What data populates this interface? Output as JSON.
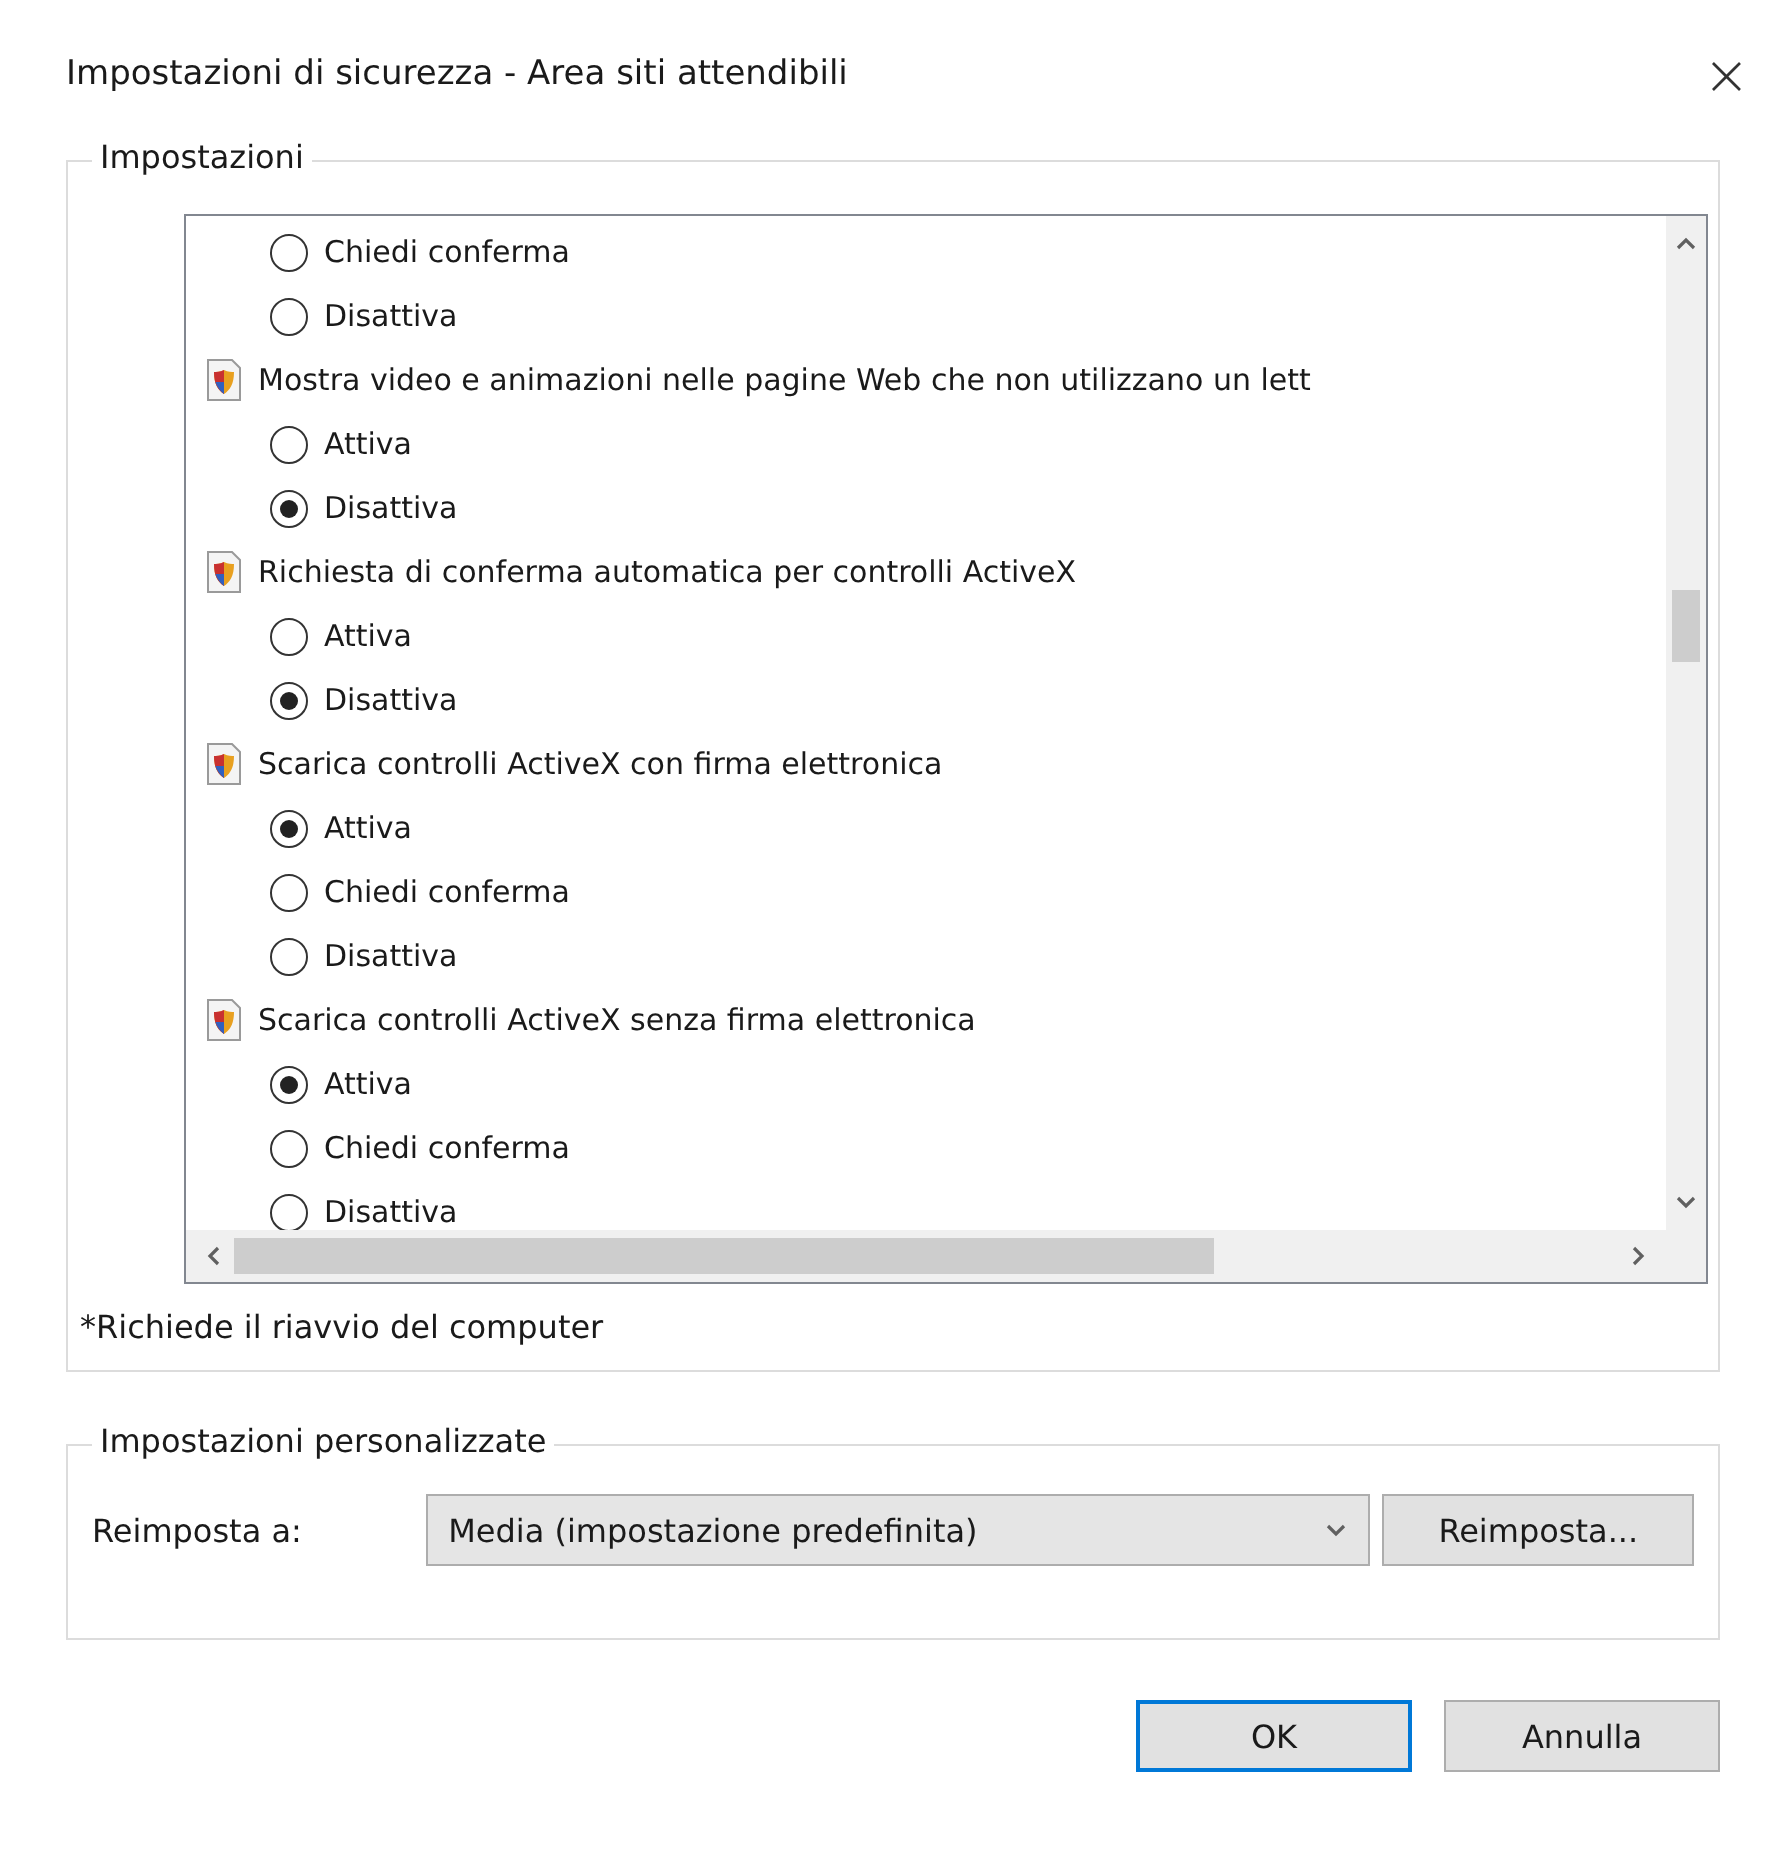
{
  "window": {
    "title": "Impostazioni di sicurezza - Area siti attendibili",
    "close": "×"
  },
  "settings": {
    "legend": "Impostazioni",
    "groups": [
      {
        "options": [
          {
            "label": "Chiedi conferma",
            "selected": false
          },
          {
            "label": "Disattiva",
            "selected": false
          }
        ]
      },
      {
        "title": "Mostra video e animazioni nelle pagine Web che non utilizzano un lett",
        "options": [
          {
            "label": "Attiva",
            "selected": false
          },
          {
            "label": "Disattiva",
            "selected": true
          }
        ]
      },
      {
        "title": "Richiesta di conferma automatica per controlli ActiveX",
        "options": [
          {
            "label": "Attiva",
            "selected": false
          },
          {
            "label": "Disattiva",
            "selected": true
          }
        ]
      },
      {
        "title": "Scarica controlli ActiveX con firma elettronica",
        "options": [
          {
            "label": "Attiva",
            "selected": true
          },
          {
            "label": "Chiedi conferma",
            "selected": false
          },
          {
            "label": "Disattiva",
            "selected": false
          }
        ]
      },
      {
        "title": "Scarica controlli ActiveX senza firma elettronica",
        "options": [
          {
            "label": "Attiva",
            "selected": true
          },
          {
            "label": "Chiedi conferma",
            "selected": false
          },
          {
            "label": "Disattiva",
            "selected": false
          }
        ]
      }
    ],
    "note": "*Richiede il riavvio del computer"
  },
  "custom": {
    "legend": "Impostazioni personalizzate",
    "label": "Reimposta a:",
    "value": "Media (impostazione predefinita)",
    "button": "Reimposta..."
  },
  "buttons": [
    {
      "label": "OK",
      "default": true
    },
    {
      "label": "Annulla",
      "default": false
    }
  ]
}
